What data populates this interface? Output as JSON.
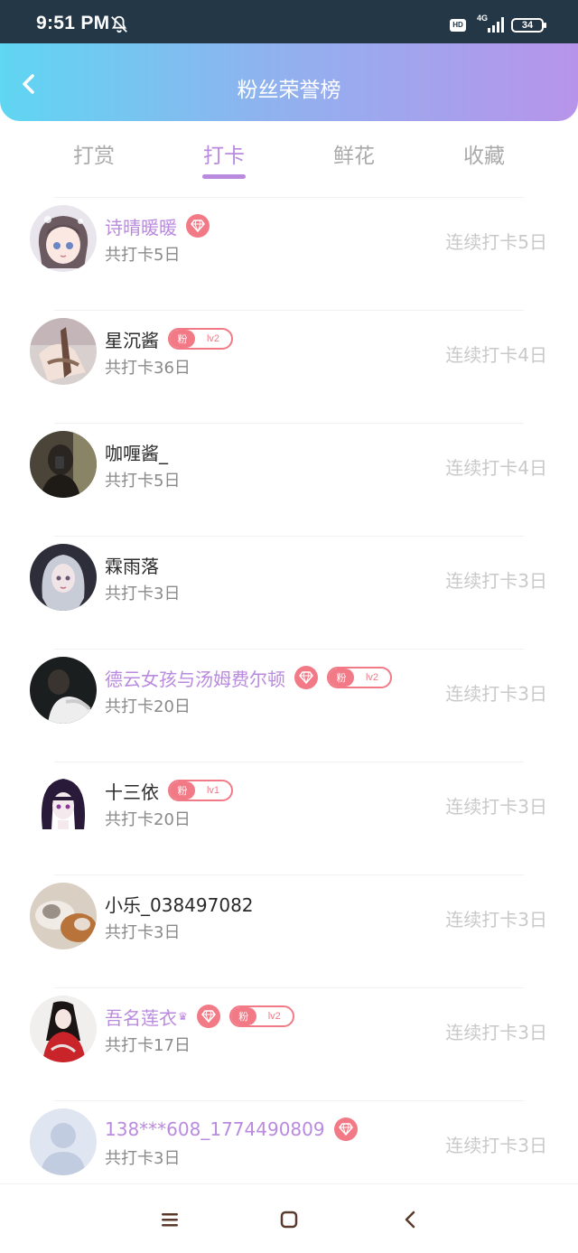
{
  "status_bar": {
    "time": "9:51 PM",
    "hd": "HD",
    "network": "4G",
    "battery": "34"
  },
  "header": {
    "title": "粉丝荣誉榜"
  },
  "tabs": [
    {
      "label": "打赏",
      "active": false
    },
    {
      "label": "打卡",
      "active": true
    },
    {
      "label": "鲜花",
      "active": false
    },
    {
      "label": "收藏",
      "active": false
    }
  ],
  "colors": {
    "accent": "#b98ade",
    "badge": "#f27a86",
    "muted": "#c9c9c9"
  },
  "fans": [
    {
      "name": "诗晴暖暖",
      "vip": true,
      "diamond": true,
      "fan_badge": null,
      "total": "共打卡5日",
      "streak": "连续打卡5日",
      "avatar": "anime-girl"
    },
    {
      "name": "星沉酱",
      "vip": false,
      "diamond": false,
      "fan_badge": {
        "label": "粉",
        "level": "lv2"
      },
      "total": "共打卡36日",
      "streak": "连续打卡4日",
      "avatar": "hands-photo"
    },
    {
      "name": "咖喱酱_",
      "vip": false,
      "diamond": false,
      "fan_badge": null,
      "total": "共打卡5日",
      "streak": "连续打卡4日",
      "avatar": "dark-selfie"
    },
    {
      "name": "霖雨落",
      "vip": false,
      "diamond": false,
      "fan_badge": null,
      "total": "共打卡3日",
      "streak": "连续打卡3日",
      "avatar": "silver-hair-girl"
    },
    {
      "name": "德云女孩与汤姆费尔顿",
      "vip": true,
      "diamond": true,
      "fan_badge": {
        "label": "粉",
        "level": "lv2"
      },
      "total": "共打卡20日",
      "streak": "连续打卡3日",
      "avatar": "fur-collar"
    },
    {
      "name": "十三依",
      "vip": false,
      "diamond": false,
      "fan_badge": {
        "label": "粉",
        "level": "lv1"
      },
      "total": "共打卡20日",
      "streak": "连续打卡3日",
      "avatar": "purple-hair-girl"
    },
    {
      "name": "小乐_038497082",
      "vip": false,
      "diamond": false,
      "fan_badge": null,
      "total": "共打卡3日",
      "streak": "连续打卡3日",
      "avatar": "cat-dog"
    },
    {
      "name": "吾名莲衣",
      "vip": true,
      "crown": true,
      "diamond": true,
      "fan_badge": {
        "label": "粉",
        "level": "lv2"
      },
      "total": "共打卡17日",
      "streak": "连续打卡3日",
      "avatar": "red-robe"
    },
    {
      "name": "138***608_1774490809",
      "vip": true,
      "diamond": true,
      "fan_badge": null,
      "total": "共打卡3日",
      "streak": "连续打卡3日",
      "avatar": "default-user"
    }
  ],
  "nav": {
    "icons": [
      "menu-icon",
      "home-square-icon",
      "back-triangle-icon"
    ]
  }
}
